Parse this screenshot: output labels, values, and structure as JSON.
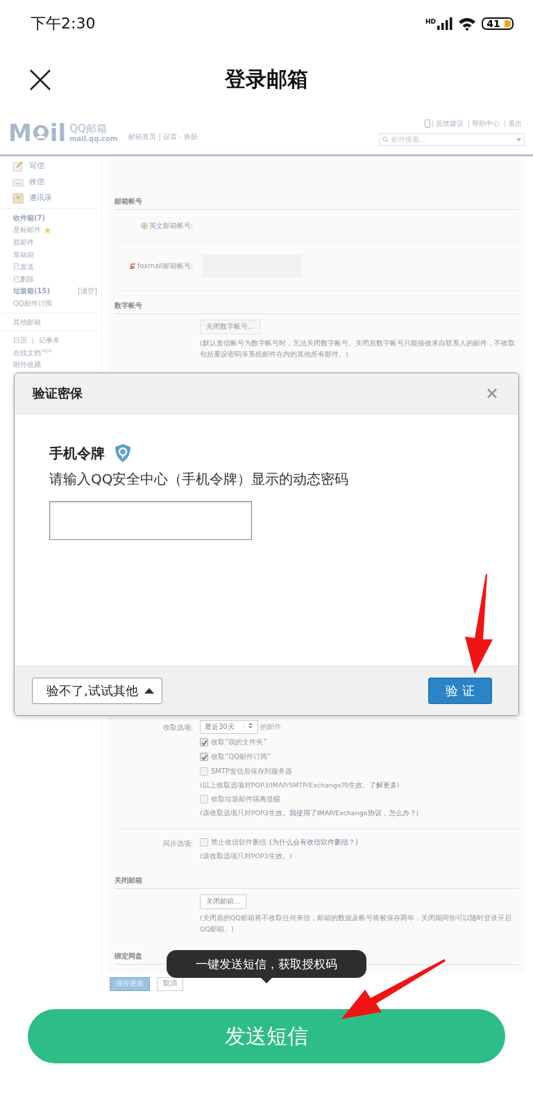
{
  "status_bar": {
    "time": "下午2:30",
    "network": "HD",
    "battery": "41"
  },
  "header": {
    "title": "登录邮箱"
  },
  "webpage": {
    "logo": {
      "left": "M",
      "right": "il",
      "brand": "QQ邮箱",
      "domain": "mail.qq.com"
    },
    "nav": "邮箱首页 | 设置 - 换肤",
    "top_links": [
      "反馈建议",
      "帮助中心",
      "退出"
    ],
    "search": {
      "placeholder": "邮件搜索..."
    },
    "sidebar": {
      "actions": [
        "写信",
        "收信",
        "通讯录"
      ],
      "folders": [
        {
          "label": "收件箱(7)",
          "bold": true,
          "starred": false
        },
        {
          "label": "星标邮件",
          "bold": false,
          "starred": true
        },
        {
          "label": "群邮件",
          "bold": false,
          "starred": false
        },
        {
          "label": "草稿箱",
          "bold": false,
          "starred": false
        },
        {
          "label": "已发送",
          "bold": false,
          "starred": false
        },
        {
          "label": "已删除",
          "bold": false,
          "starred": false
        },
        {
          "label": "垃圾箱(15)",
          "bold": true,
          "starred": false,
          "action": "[清空]"
        },
        {
          "label": "QQ邮件订阅",
          "bold": false,
          "starred": false
        }
      ],
      "other": "其他邮箱",
      "tools": [
        {
          "kind": "inline",
          "label": "日历"
        },
        {
          "kind": "inline",
          "label": "记事本"
        },
        {
          "kind": "line",
          "label": "在线文档",
          "badge": "NEW"
        },
        {
          "kind": "line",
          "label": "附件收藏"
        }
      ]
    },
    "sections": [
      {
        "title": "邮箱帐号",
        "rows": [
          {
            "label": "英文邮箱帐号:",
            "field": false
          },
          {
            "label": "foxmail邮箱帐号:",
            "field": true
          }
        ]
      },
      {
        "title": "数字帐号",
        "button": "关闭数字帐号...",
        "note": "(默认发信帐号为数字帐号时，无法关闭数字帐号。关闭后数字帐号只能接收来自联系人的邮件，不收取包括重设密码等系统邮件在内的其他所有邮件。)"
      }
    ],
    "receive": {
      "label": "收取选项:",
      "select": "最近30天",
      "suffix": "的邮件",
      "options": [
        {
          "kind": "checkbox",
          "label": "收取“我的文件夹”",
          "checked": true
        },
        {
          "kind": "checkbox",
          "label": "收取“QQ邮件订阅”",
          "checked": true
        },
        {
          "kind": "checkbox",
          "label": "SMTP发信后保存到服务器",
          "checked": false
        },
        {
          "kind": "note",
          "text": "(以上收取选项对POP3/IMAP/SMTP/Exchange均生效。",
          "link": "了解更多",
          "after": ")"
        },
        {
          "kind": "checkbox",
          "label": "收取垃圾邮件隔离提醒",
          "checked": false
        },
        {
          "kind": "note",
          "text": "(该收取选项只对POP3生效。",
          "link": "我使用了IMAP/Exchange协议，怎么办？",
          "after": ")"
        }
      ]
    },
    "sync": {
      "label": "同步选项:",
      "option": {
        "label": "禁止收信软件删信",
        "hint": "(为什么会有收信软件删信？)",
        "checked": false
      },
      "note": "(该收取选项只对POP3生效。)"
    },
    "close": {
      "title": "关闭邮箱",
      "button": "关闭邮箱...",
      "note": "(关闭后的QQ邮箱将不收取任何来信，邮箱的数据及帐号将被保存两年，关闭期间你可以随时登录开启QQ邮箱。)"
    },
    "netdisk": {
      "title": "绑定网盘"
    },
    "buttons": [
      "保存更改",
      "取消"
    ]
  },
  "dialog": {
    "title": "验证密保",
    "heading": "手机令牌",
    "instruction": "请输入QQ安全中心（手机令牌）显示的动态密码",
    "alt_button": "验不了,试试其他",
    "submit": "验 证"
  },
  "tooltip": "一键发送短信，获取授权码",
  "primary_button": "发送短信"
}
